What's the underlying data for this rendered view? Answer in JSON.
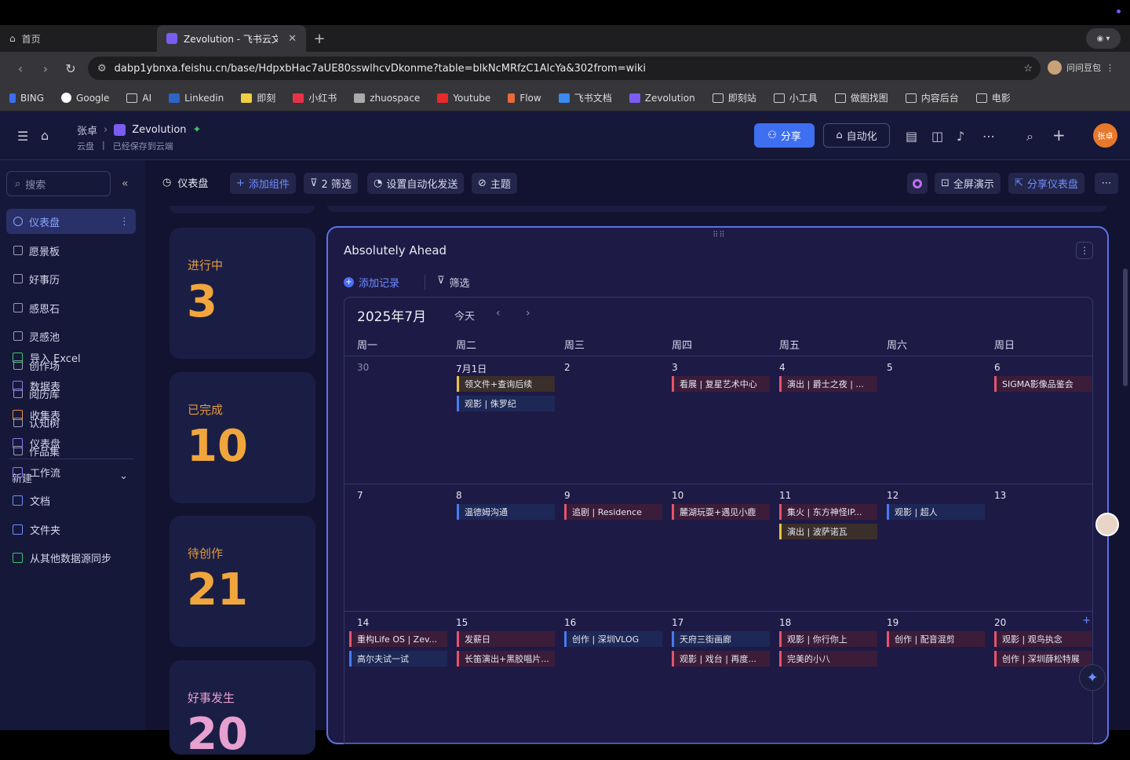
{
  "browser": {
    "tabs": [
      {
        "label": "首页"
      },
      {
        "label": "Zevolution - 飞书云文档"
      }
    ],
    "url": "dabp1ybnxa.feishu.cn/base/HdpxbHac7aUE80sswlhcvDkonme?table=blkNcMRfzC1AlcYa&302from=wiki",
    "profile_label": "问问豆包",
    "bookmarks": [
      "BING",
      "Google",
      "AI",
      "Linkedin",
      "即刻",
      "小红书",
      "zhuospace",
      "Youtube",
      "Flow",
      "飞书文档",
      "Zevolution",
      "即刻站",
      "小工具",
      "做图找图",
      "内容后台",
      "电影"
    ]
  },
  "header": {
    "owner": "张卓",
    "title": "Zevolution",
    "location": "云盘",
    "save_status": "已经保存到云端",
    "share_label": "分享",
    "automation_label": "自动化",
    "avatar_text": "张卓"
  },
  "sidebar": {
    "search_placeholder": "搜索",
    "items": [
      {
        "label": "仪表盘",
        "active": true
      },
      {
        "label": "愿景板"
      },
      {
        "label": "好事历"
      },
      {
        "label": "感恩石"
      },
      {
        "label": "灵感池"
      },
      {
        "label": "创作场"
      },
      {
        "label": "阅历库"
      },
      {
        "label": "认知树"
      },
      {
        "label": "作品集"
      }
    ],
    "new_label": "新建",
    "create_items": [
      {
        "label": "导入 Excel",
        "color": "#3ec46d"
      },
      {
        "label": "数据表",
        "color": "#8a7cf0"
      },
      {
        "label": "收集表",
        "color": "#f08a3a"
      },
      {
        "label": "仪表盘",
        "color": "#8a7cf0"
      },
      {
        "label": "工作流",
        "color": "#8a7cf0"
      },
      {
        "label": "文档",
        "color": "#6e8dff"
      },
      {
        "label": "文件夹",
        "color": "#6e8dff"
      },
      {
        "label": "从其他数据源同步",
        "color": "#3ec46d"
      }
    ]
  },
  "toolbar": {
    "title": "仪表盘",
    "add_component": "添加组件",
    "filter": "2 筛选",
    "auto_send": "设置自动化发送",
    "theme": "主题",
    "fullscreen": "全屏演示",
    "share_dashboard": "分享仪表盘"
  },
  "stats": [
    {
      "label": "进行中",
      "value": "3"
    },
    {
      "label": "已完成",
      "value": "10"
    },
    {
      "label": "待创作",
      "value": "21"
    },
    {
      "label": "好事发生",
      "value": "20"
    }
  ],
  "calendar": {
    "widget_title": "Absolutely Ahead",
    "add_record": "添加记录",
    "filter": "筛选",
    "month": "2025年7月",
    "today": "今天",
    "weekdays": [
      "周一",
      "周二",
      "周三",
      "周四",
      "周五",
      "周六",
      "周日"
    ],
    "weeks": [
      {
        "days": [
          "30",
          "7月1日",
          "2",
          "3",
          "4",
          "5",
          "6"
        ],
        "events": [
          {
            "col": 1,
            "row": 0,
            "text": "领文件+查询后续",
            "color": "yellow"
          },
          {
            "col": 1,
            "row": 1,
            "text": "观影 | 侏罗纪",
            "color": "blue"
          },
          {
            "col": 3,
            "row": 0,
            "text": "看展 | 复星艺术中心",
            "color": "red"
          },
          {
            "col": 4,
            "row": 0,
            "text": "演出 | 爵士之夜 | ...",
            "color": "red"
          },
          {
            "col": 6,
            "row": 0,
            "text": "SIGMA影像品鉴会",
            "color": "red"
          }
        ]
      },
      {
        "days": [
          "7",
          "8",
          "9",
          "10",
          "11",
          "12",
          "13"
        ],
        "events": [
          {
            "col": 1,
            "row": 0,
            "text": "温德姆沟通",
            "color": "blue"
          },
          {
            "col": 2,
            "row": 0,
            "text": "追剧 | Residence",
            "color": "red"
          },
          {
            "col": 3,
            "row": 0,
            "text": "麓湖玩耍+遇见小鹿",
            "color": "red"
          },
          {
            "col": 4,
            "row": 0,
            "text": "集火 | 东方神怪IP...",
            "color": "red"
          },
          {
            "col": 4,
            "row": 1,
            "text": "演出 | 波萨诺瓦",
            "color": "yellow"
          },
          {
            "col": 5,
            "row": 0,
            "text": "观影 | 超人",
            "color": "blue"
          }
        ]
      },
      {
        "days": [
          "14",
          "15",
          "16",
          "17",
          "18",
          "19",
          "20"
        ],
        "events": [
          {
            "col": 0,
            "row": 0,
            "text": "重构Life OS | Zev...",
            "color": "red"
          },
          {
            "col": 0,
            "row": 1,
            "text": "高尔夫试一试",
            "color": "blue"
          },
          {
            "col": 1,
            "row": 0,
            "text": "发薪日",
            "color": "red"
          },
          {
            "col": 1,
            "row": 1,
            "text": "长笛演出+黑胶唱片...",
            "color": "red"
          },
          {
            "col": 2,
            "row": 0,
            "text": "创作 | 深圳VLOG",
            "color": "blue"
          },
          {
            "col": 3,
            "row": 0,
            "text": "天府三街画廊",
            "color": "blue"
          },
          {
            "col": 3,
            "row": 1,
            "text": "观影 | 戏台 | 再度...",
            "color": "red"
          },
          {
            "col": 4,
            "row": 0,
            "text": "观影 | 你行你上",
            "color": "red"
          },
          {
            "col": 4,
            "row": 1,
            "text": "完美的小八",
            "color": "red"
          },
          {
            "col": 5,
            "row": 0,
            "text": "创作 | 配音混剪",
            "color": "red"
          },
          {
            "col": 6,
            "row": 0,
            "text": "观影 | 观鸟执念",
            "color": "red"
          },
          {
            "col": 6,
            "row": 1,
            "text": "创作 | 深圳薛松特展",
            "color": "red"
          }
        ]
      }
    ]
  }
}
